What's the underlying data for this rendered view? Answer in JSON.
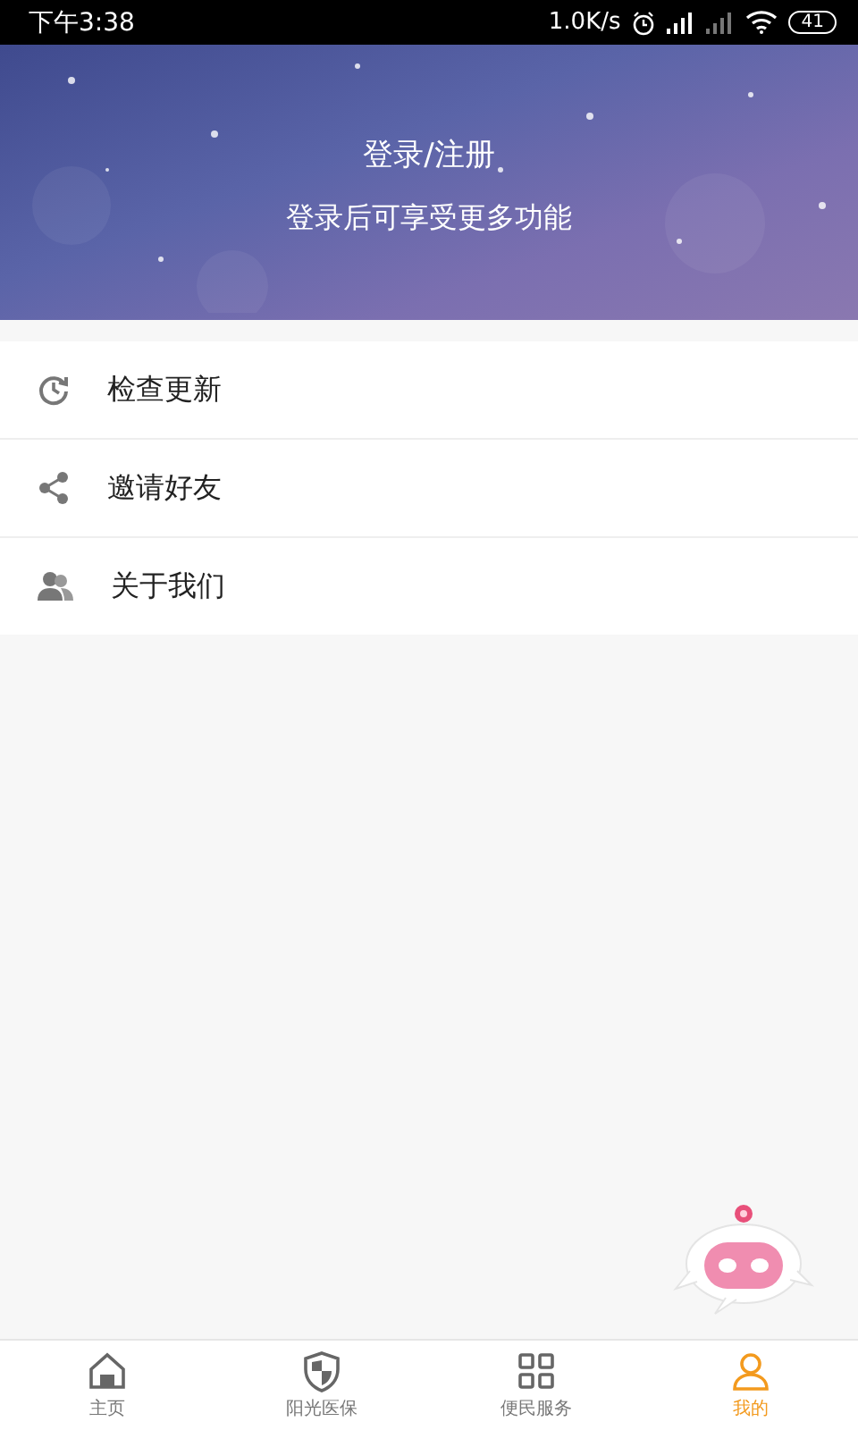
{
  "status_bar": {
    "time": "下午3:38",
    "speed": "1.0K/s",
    "battery": "41"
  },
  "header": {
    "title": "登录/注册",
    "subtitle": "登录后可享受更多功能"
  },
  "menu": [
    {
      "kind": "update",
      "label": "检查更新"
    },
    {
      "kind": "share",
      "label": "邀请好友"
    },
    {
      "kind": "about",
      "label": "关于我们"
    }
  ],
  "tabs": [
    {
      "kind": "home",
      "label": "主页",
      "selected": false
    },
    {
      "kind": "shield",
      "label": "阳光医保",
      "selected": false
    },
    {
      "kind": "service",
      "label": "便民服务",
      "selected": false
    },
    {
      "kind": "user",
      "label": "我的",
      "selected": true
    }
  ]
}
